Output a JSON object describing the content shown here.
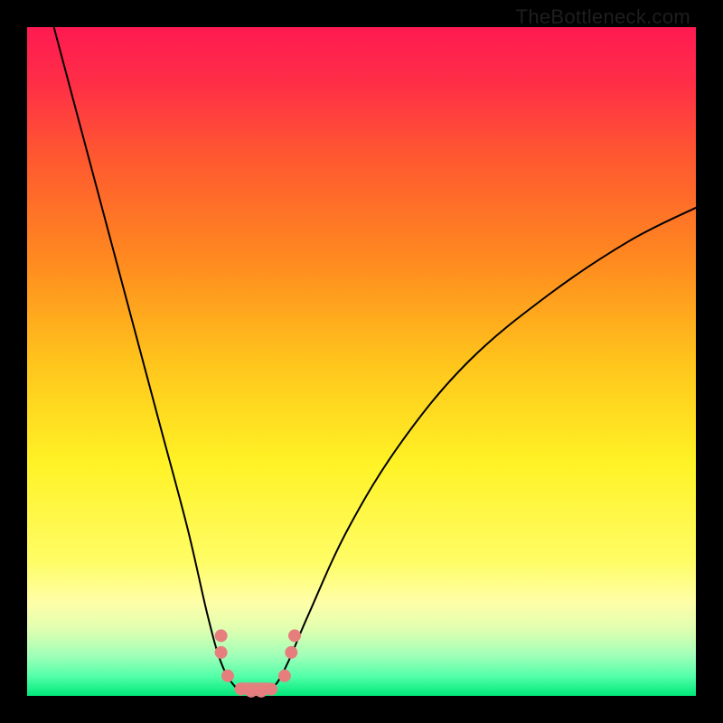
{
  "watermark": "TheBottleneck.com",
  "colors": {
    "black": "#000000",
    "curve": "#000000",
    "marker_fill": "#e77e7e",
    "gradient_stops": [
      {
        "offset": 0.0,
        "color": "#ff1a52"
      },
      {
        "offset": 0.08,
        "color": "#ff2d47"
      },
      {
        "offset": 0.2,
        "color": "#ff5a2f"
      },
      {
        "offset": 0.35,
        "color": "#ff8a1f"
      },
      {
        "offset": 0.5,
        "color": "#ffc41c"
      },
      {
        "offset": 0.65,
        "color": "#fff225"
      },
      {
        "offset": 0.8,
        "color": "#fffd66"
      },
      {
        "offset": 0.86,
        "color": "#fffea8"
      },
      {
        "offset": 0.9,
        "color": "#e0ffb0"
      },
      {
        "offset": 0.94,
        "color": "#a0ffb8"
      },
      {
        "offset": 0.97,
        "color": "#55ffaa"
      },
      {
        "offset": 1.0,
        "color": "#00e87a"
      }
    ]
  },
  "chart_data": {
    "type": "line",
    "title": "",
    "xlabel": "",
    "ylabel": "",
    "ylim": [
      0,
      100
    ],
    "xlim": [
      0,
      100
    ],
    "curve_points": [
      {
        "x": 4,
        "y": 100
      },
      {
        "x": 8,
        "y": 85
      },
      {
        "x": 12,
        "y": 70
      },
      {
        "x": 16,
        "y": 55
      },
      {
        "x": 20,
        "y": 40
      },
      {
        "x": 24,
        "y": 25
      },
      {
        "x": 27,
        "y": 12
      },
      {
        "x": 29,
        "y": 5
      },
      {
        "x": 31,
        "y": 1.5
      },
      {
        "x": 33,
        "y": 0.5
      },
      {
        "x": 35,
        "y": 0.5
      },
      {
        "x": 37,
        "y": 1.5
      },
      {
        "x": 39,
        "y": 5
      },
      {
        "x": 42,
        "y": 12
      },
      {
        "x": 48,
        "y": 25
      },
      {
        "x": 56,
        "y": 38
      },
      {
        "x": 66,
        "y": 50
      },
      {
        "x": 78,
        "y": 60
      },
      {
        "x": 90,
        "y": 68
      },
      {
        "x": 100,
        "y": 73
      }
    ],
    "markers": [
      {
        "x": 29,
        "y": 9.0
      },
      {
        "x": 29,
        "y": 6.5
      },
      {
        "x": 30,
        "y": 3.0
      },
      {
        "x": 32,
        "y": 1.0
      },
      {
        "x": 33.5,
        "y": 0.7
      },
      {
        "x": 35,
        "y": 0.7
      },
      {
        "x": 36.5,
        "y": 1.0
      },
      {
        "x": 38.5,
        "y": 3.0
      },
      {
        "x": 39.5,
        "y": 6.5
      },
      {
        "x": 40,
        "y": 9.0
      }
    ],
    "pink_band": {
      "y_from": 0.2,
      "y_to": 2.0,
      "x_from": 31,
      "x_to": 37
    }
  }
}
